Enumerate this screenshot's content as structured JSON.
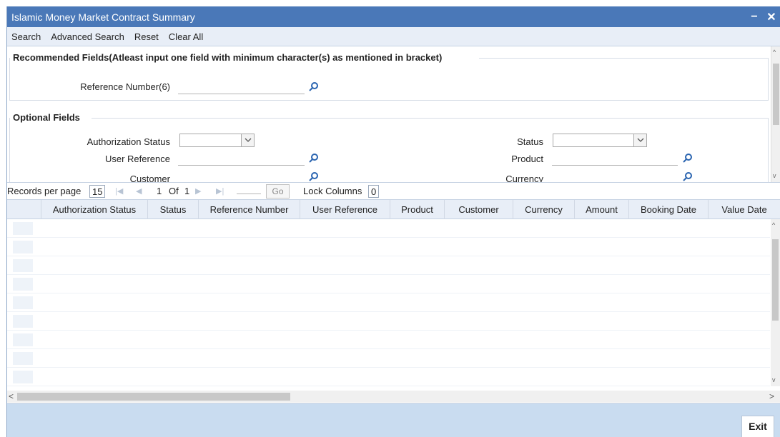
{
  "window": {
    "title": "Islamic Money Market Contract Summary",
    "minimize": "−",
    "close": "✕"
  },
  "toolbar": {
    "search": "Search",
    "advanced_search": "Advanced Search",
    "reset": "Reset",
    "clear_all": "Clear All"
  },
  "recommended": {
    "heading": "Recommended Fields(Atleast input one field with minimum character(s) as mentioned in bracket)",
    "reference_number_label": "Reference Number(6)"
  },
  "optional": {
    "heading": "Optional Fields",
    "authorization_status_label": "Authorization Status",
    "user_reference_label": "User Reference",
    "customer_label": "Customer",
    "status_label": "Status",
    "product_label": "Product",
    "currency_label": "Currency"
  },
  "pager": {
    "records_per_page_label": "Records per page",
    "records_per_page_value": "15",
    "current_page": "1",
    "of_label": "Of",
    "total_pages": "1",
    "go_label": "Go",
    "lock_columns_label": "Lock Columns",
    "lock_columns_value": "0"
  },
  "grid": {
    "columns": [
      "Authorization Status",
      "Status",
      "Reference Number",
      "User Reference",
      "Product",
      "Customer",
      "Currency",
      "Amount",
      "Booking Date",
      "Value Date"
    ]
  },
  "footer": {
    "exit_label": "Exit"
  },
  "colors": {
    "titlebar": "#4a78b8",
    "toolbar": "#e8eef7",
    "footer": "#c9dcf0"
  }
}
